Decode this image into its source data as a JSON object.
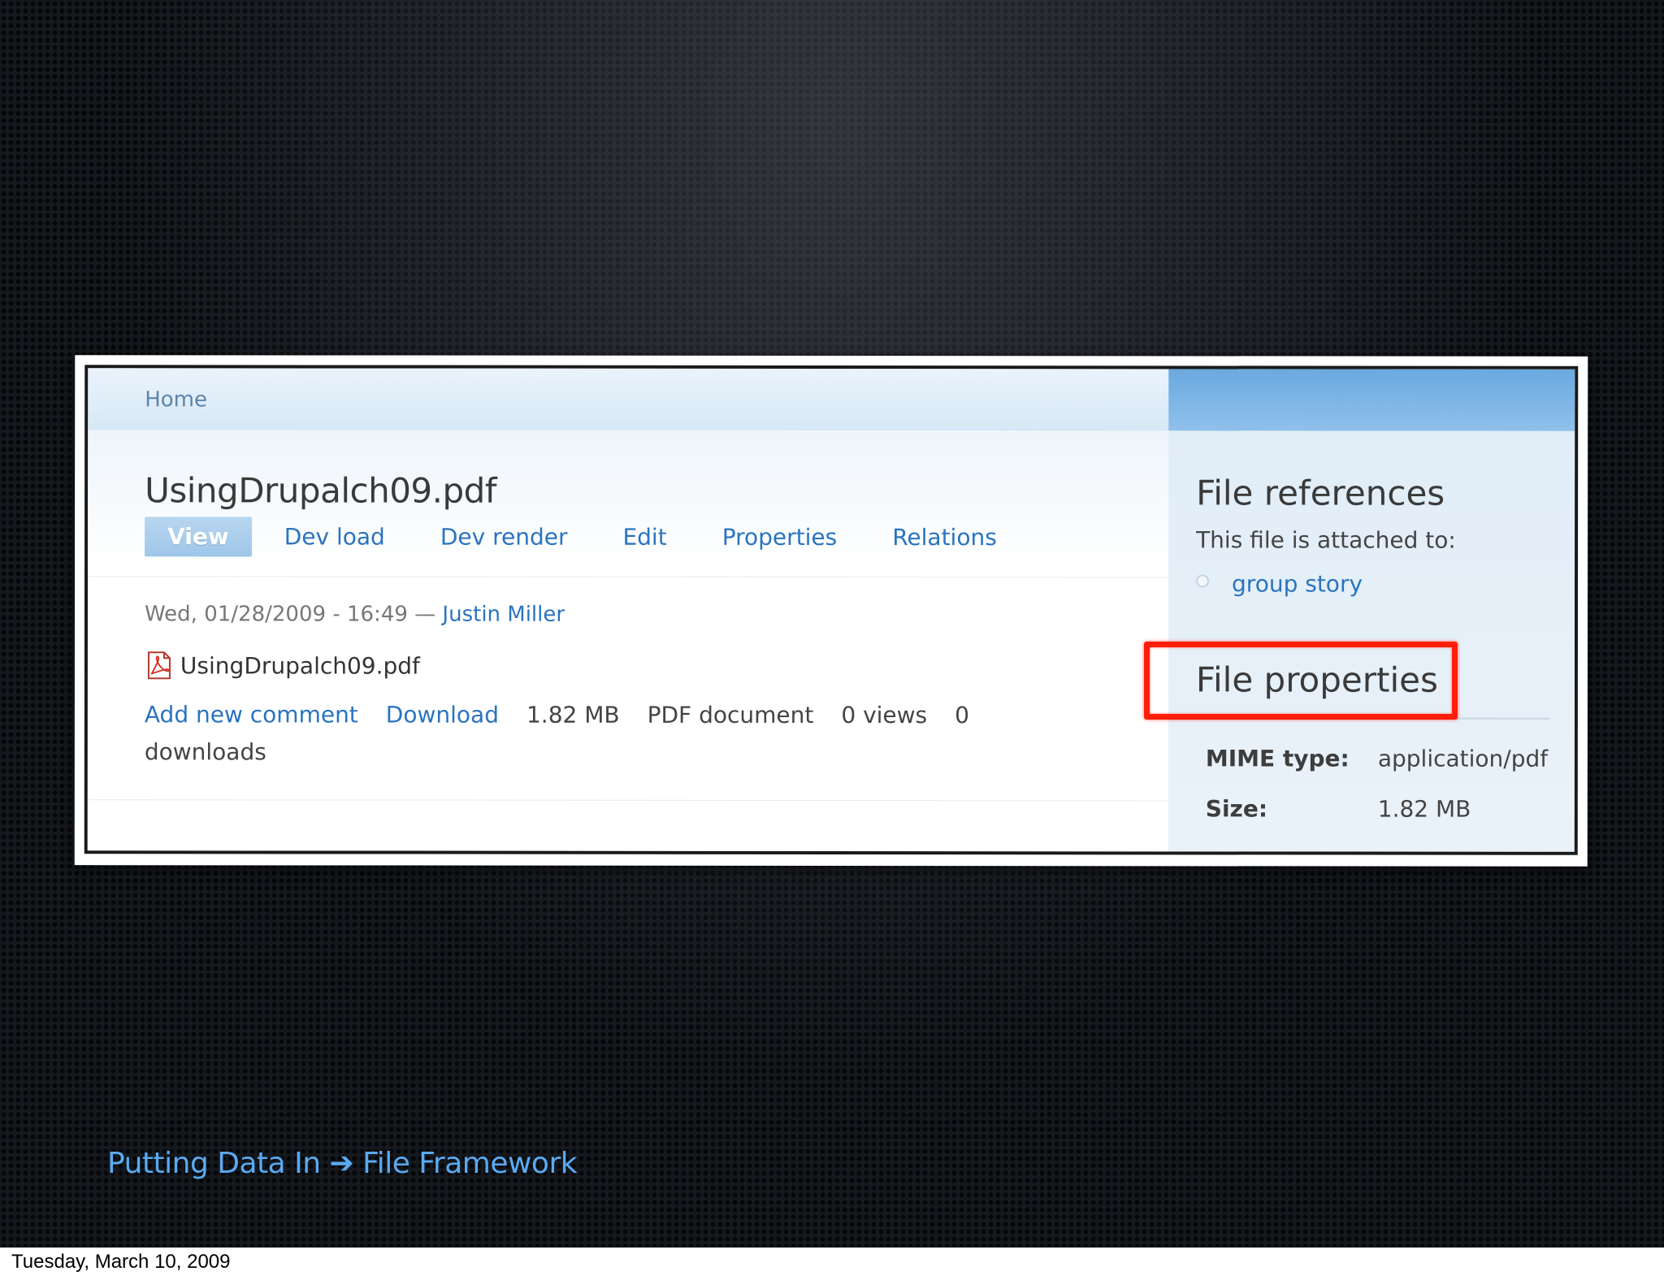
{
  "breadcrumb": "Home",
  "page_title": "UsingDrupalch09.pdf",
  "tabs": [
    {
      "label": "View",
      "active": true
    },
    {
      "label": "Dev load"
    },
    {
      "label": "Dev render"
    },
    {
      "label": "Edit"
    },
    {
      "label": "Properties"
    },
    {
      "label": "Relations"
    }
  ],
  "meta": {
    "date": "Wed, 01/28/2009 - 16:49 — ",
    "author": "Justin Miller"
  },
  "file": {
    "icon": "pdf-icon",
    "name": "UsingDrupalch09.pdf"
  },
  "links": {
    "add_comment": "Add new comment",
    "download": "Download",
    "size": "1.82 MB",
    "type": "PDF document",
    "views": "0 views",
    "downloads": "0 downloads"
  },
  "sidebar": {
    "references_title": "File references",
    "attached_text": "This file is attached to:",
    "attached_item": "group story",
    "properties_title": "File properties",
    "mime_label": "MIME type:",
    "mime_value": "application/pdf",
    "size_label": "Size:",
    "size_value": "1.82 MB"
  },
  "caption": "Putting Data In ➔ File Framework",
  "footer_date": "Tuesday, March 10, 2009",
  "colors": {
    "link": "#2a74bf",
    "highlight": "#ff1e0a",
    "caption": "#5aaaf2"
  }
}
